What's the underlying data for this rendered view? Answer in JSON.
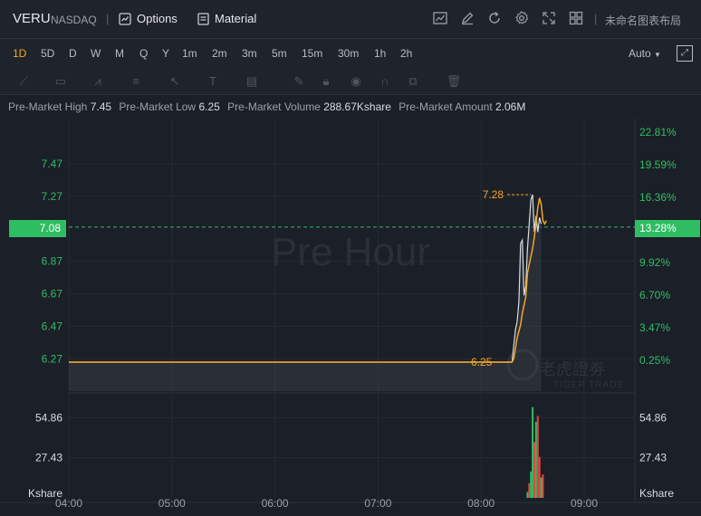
{
  "header": {
    "symbol": "VERU",
    "exchange": "NASDAQ",
    "options_label": "Options",
    "material_label": "Material",
    "layout_name": "未命名图表布局"
  },
  "periods": [
    "1D",
    "5D",
    "D",
    "W",
    "M",
    "Q",
    "Y",
    "1m",
    "2m",
    "3m",
    "5m",
    "15m",
    "30m",
    "1h",
    "2h"
  ],
  "active_period": "1D",
  "scale_mode": "Auto",
  "stats": {
    "high_label": "Pre-Market High",
    "high_value": "7.45",
    "low_label": "Pre-Market Low",
    "low_value": "6.25",
    "volume_label": "Pre-Market Volume",
    "volume_value": "288.67Kshare",
    "amount_label": "Pre-Market Amount",
    "amount_value": "2.06M"
  },
  "current_price_badge": "7.08",
  "current_pct_badge": "13.28%",
  "watermark": "Pre Hour",
  "brand_watermark_cn": "老虎證劵",
  "brand_watermark_en": "TIGER TRADE",
  "colors": {
    "up": "#2fbd62",
    "down": "#e84141",
    "line": "#f5a623",
    "bg": "#1b1f27"
  },
  "chart_data": {
    "type": "line",
    "x_ticks": [
      "04:00",
      "05:00",
      "06:00",
      "07:00",
      "08:00",
      "09:00"
    ],
    "price_ticks": [
      "7.47",
      "7.27",
      "6.87",
      "6.67",
      "6.47",
      "6.27"
    ],
    "pct_ticks": [
      "22.81%",
      "19.59%",
      "16.36%",
      "9.92%",
      "6.70%",
      "3.47%",
      "0.25%"
    ],
    "volume_ticks": [
      "54.86",
      "27.43"
    ],
    "volume_unit": "Kshare",
    "ylim": [
      6.05,
      7.6
    ],
    "series": [
      {
        "values": [
          [
            "04:00",
            6.25
          ],
          [
            "05:00",
            6.25
          ],
          [
            "06:00",
            6.25
          ],
          [
            "07:00",
            6.25
          ],
          [
            "08:00",
            6.25
          ],
          [
            "08:18",
            6.25
          ],
          [
            "08:19",
            6.27
          ],
          [
            "08:21",
            6.4
          ],
          [
            "08:23",
            6.48
          ],
          [
            "08:24",
            6.55
          ],
          [
            "08:26",
            6.65
          ],
          [
            "08:27",
            6.8
          ],
          [
            "08:29",
            6.9
          ],
          [
            "08:30",
            6.95
          ],
          [
            "08:31",
            7.02
          ],
          [
            "08:32",
            7.1
          ],
          [
            "08:33",
            7.2
          ],
          [
            "08:34",
            7.26
          ],
          [
            "08:35",
            7.22
          ],
          [
            "08:36",
            7.12
          ],
          [
            "08:37",
            7.1
          ],
          [
            "08:38",
            7.12
          ]
        ]
      }
    ],
    "close_series": [
      [
        "04:00",
        6.25
      ],
      [
        "08:18",
        6.25
      ],
      [
        "08:19",
        6.35
      ],
      [
        "08:20",
        6.45
      ],
      [
        "08:21",
        6.5
      ],
      [
        "08:22",
        6.62
      ],
      [
        "08:23",
        6.98
      ],
      [
        "08:24",
        7.0
      ],
      [
        "08:25",
        6.66
      ],
      [
        "08:26",
        6.72
      ],
      [
        "08:27",
        6.95
      ],
      [
        "08:28",
        7.1
      ],
      [
        "08:29",
        7.25
      ],
      [
        "08:30",
        7.28
      ],
      [
        "08:31",
        7.05
      ],
      [
        "08:32",
        7.15
      ],
      [
        "08:33",
        7.05
      ],
      [
        "08:34",
        7.14
      ],
      [
        "08:35",
        7.1
      ]
    ],
    "annotations": [
      {
        "text": "7.28",
        "value": 7.28,
        "label": "high"
      },
      {
        "text": "6.25",
        "value": 6.25,
        "label": "low"
      }
    ],
    "volume_bars": [
      {
        "t": "08:27",
        "v": 4,
        "dir": "up"
      },
      {
        "t": "08:28",
        "v": 10,
        "dir": "down"
      },
      {
        "t": "08:29",
        "v": 18,
        "dir": "up"
      },
      {
        "t": "08:30",
        "v": 62,
        "dir": "up"
      },
      {
        "t": "08:31",
        "v": 38,
        "dir": "down"
      },
      {
        "t": "08:32",
        "v": 52,
        "dir": "up"
      },
      {
        "t": "08:33",
        "v": 56,
        "dir": "down"
      },
      {
        "t": "08:34",
        "v": 28,
        "dir": "down"
      },
      {
        "t": "08:35",
        "v": 14,
        "dir": "up"
      },
      {
        "t": "08:36",
        "v": 16,
        "dir": "down"
      }
    ],
    "grid": true
  }
}
